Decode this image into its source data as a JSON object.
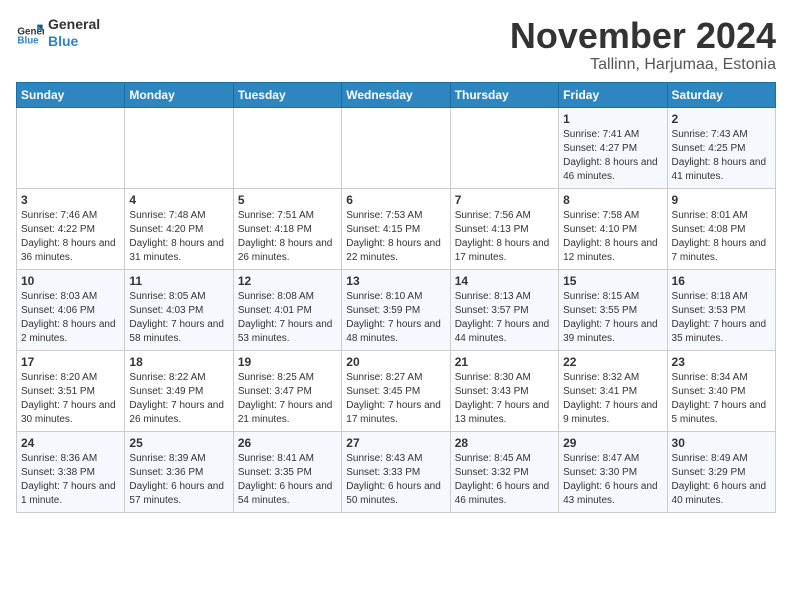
{
  "logo": {
    "text_general": "General",
    "text_blue": "Blue"
  },
  "title": "November 2024",
  "location": "Tallinn, Harjumaa, Estonia",
  "days_of_week": [
    "Sunday",
    "Monday",
    "Tuesday",
    "Wednesday",
    "Thursday",
    "Friday",
    "Saturday"
  ],
  "weeks": [
    [
      {
        "day": "",
        "info": ""
      },
      {
        "day": "",
        "info": ""
      },
      {
        "day": "",
        "info": ""
      },
      {
        "day": "",
        "info": ""
      },
      {
        "day": "",
        "info": ""
      },
      {
        "day": "1",
        "info": "Sunrise: 7:41 AM\nSunset: 4:27 PM\nDaylight: 8 hours and 46 minutes."
      },
      {
        "day": "2",
        "info": "Sunrise: 7:43 AM\nSunset: 4:25 PM\nDaylight: 8 hours and 41 minutes."
      }
    ],
    [
      {
        "day": "3",
        "info": "Sunrise: 7:46 AM\nSunset: 4:22 PM\nDaylight: 8 hours and 36 minutes."
      },
      {
        "day": "4",
        "info": "Sunrise: 7:48 AM\nSunset: 4:20 PM\nDaylight: 8 hours and 31 minutes."
      },
      {
        "day": "5",
        "info": "Sunrise: 7:51 AM\nSunset: 4:18 PM\nDaylight: 8 hours and 26 minutes."
      },
      {
        "day": "6",
        "info": "Sunrise: 7:53 AM\nSunset: 4:15 PM\nDaylight: 8 hours and 22 minutes."
      },
      {
        "day": "7",
        "info": "Sunrise: 7:56 AM\nSunset: 4:13 PM\nDaylight: 8 hours and 17 minutes."
      },
      {
        "day": "8",
        "info": "Sunrise: 7:58 AM\nSunset: 4:10 PM\nDaylight: 8 hours and 12 minutes."
      },
      {
        "day": "9",
        "info": "Sunrise: 8:01 AM\nSunset: 4:08 PM\nDaylight: 8 hours and 7 minutes."
      }
    ],
    [
      {
        "day": "10",
        "info": "Sunrise: 8:03 AM\nSunset: 4:06 PM\nDaylight: 8 hours and 2 minutes."
      },
      {
        "day": "11",
        "info": "Sunrise: 8:05 AM\nSunset: 4:03 PM\nDaylight: 7 hours and 58 minutes."
      },
      {
        "day": "12",
        "info": "Sunrise: 8:08 AM\nSunset: 4:01 PM\nDaylight: 7 hours and 53 minutes."
      },
      {
        "day": "13",
        "info": "Sunrise: 8:10 AM\nSunset: 3:59 PM\nDaylight: 7 hours and 48 minutes."
      },
      {
        "day": "14",
        "info": "Sunrise: 8:13 AM\nSunset: 3:57 PM\nDaylight: 7 hours and 44 minutes."
      },
      {
        "day": "15",
        "info": "Sunrise: 8:15 AM\nSunset: 3:55 PM\nDaylight: 7 hours and 39 minutes."
      },
      {
        "day": "16",
        "info": "Sunrise: 8:18 AM\nSunset: 3:53 PM\nDaylight: 7 hours and 35 minutes."
      }
    ],
    [
      {
        "day": "17",
        "info": "Sunrise: 8:20 AM\nSunset: 3:51 PM\nDaylight: 7 hours and 30 minutes."
      },
      {
        "day": "18",
        "info": "Sunrise: 8:22 AM\nSunset: 3:49 PM\nDaylight: 7 hours and 26 minutes."
      },
      {
        "day": "19",
        "info": "Sunrise: 8:25 AM\nSunset: 3:47 PM\nDaylight: 7 hours and 21 minutes."
      },
      {
        "day": "20",
        "info": "Sunrise: 8:27 AM\nSunset: 3:45 PM\nDaylight: 7 hours and 17 minutes."
      },
      {
        "day": "21",
        "info": "Sunrise: 8:30 AM\nSunset: 3:43 PM\nDaylight: 7 hours and 13 minutes."
      },
      {
        "day": "22",
        "info": "Sunrise: 8:32 AM\nSunset: 3:41 PM\nDaylight: 7 hours and 9 minutes."
      },
      {
        "day": "23",
        "info": "Sunrise: 8:34 AM\nSunset: 3:40 PM\nDaylight: 7 hours and 5 minutes."
      }
    ],
    [
      {
        "day": "24",
        "info": "Sunrise: 8:36 AM\nSunset: 3:38 PM\nDaylight: 7 hours and 1 minute."
      },
      {
        "day": "25",
        "info": "Sunrise: 8:39 AM\nSunset: 3:36 PM\nDaylight: 6 hours and 57 minutes."
      },
      {
        "day": "26",
        "info": "Sunrise: 8:41 AM\nSunset: 3:35 PM\nDaylight: 6 hours and 54 minutes."
      },
      {
        "day": "27",
        "info": "Sunrise: 8:43 AM\nSunset: 3:33 PM\nDaylight: 6 hours and 50 minutes."
      },
      {
        "day": "28",
        "info": "Sunrise: 8:45 AM\nSunset: 3:32 PM\nDaylight: 6 hours and 46 minutes."
      },
      {
        "day": "29",
        "info": "Sunrise: 8:47 AM\nSunset: 3:30 PM\nDaylight: 6 hours and 43 minutes."
      },
      {
        "day": "30",
        "info": "Sunrise: 8:49 AM\nSunset: 3:29 PM\nDaylight: 6 hours and 40 minutes."
      }
    ]
  ]
}
